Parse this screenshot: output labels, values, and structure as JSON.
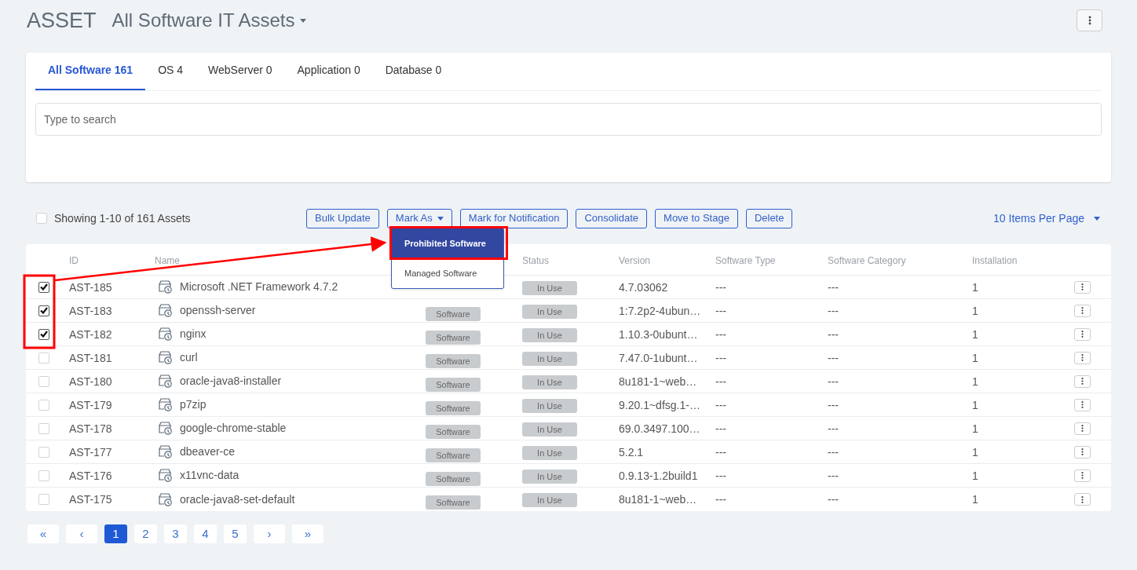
{
  "header": {
    "module": "ASSET",
    "view": "All Software IT Assets"
  },
  "tabs": [
    {
      "label": "All Software 161",
      "selected": true
    },
    {
      "label": "OS 4",
      "selected": false
    },
    {
      "label": "WebServer 0",
      "selected": false
    },
    {
      "label": "Application 0",
      "selected": false
    },
    {
      "label": "Database 0",
      "selected": false
    }
  ],
  "search": {
    "placeholder": "Type to search"
  },
  "toolbar": {
    "select_all_checked": false,
    "summary": "Showing 1-10 of 161 Assets",
    "actions": [
      {
        "label": "Bulk Update",
        "kind": "button"
      },
      {
        "label": "Mark As",
        "kind": "dropdown"
      },
      {
        "label": "Mark for Notification",
        "kind": "button"
      },
      {
        "label": "Consolidate",
        "kind": "button"
      },
      {
        "label": "Move to Stage",
        "kind": "button"
      },
      {
        "label": "Delete",
        "kind": "button"
      }
    ],
    "page_size": "10 Items Per Page"
  },
  "mark_as_menu": [
    {
      "label": "Prohibited Software",
      "selected": true
    },
    {
      "label": "Managed Software",
      "selected": false
    }
  ],
  "table": {
    "columns": [
      "ID",
      "Name",
      "Status",
      "Version",
      "Software Type",
      "Software Category",
      "Installation"
    ],
    "rows": [
      {
        "checked": true,
        "id": "AST-185",
        "name": "Microsoft .NET Framework 4.7.2",
        "status": "In Use",
        "version": "4.7.03062",
        "software_type": "---",
        "category": "---",
        "installation": "1"
      },
      {
        "checked": true,
        "id": "AST-183",
        "name": "openssh-server",
        "type": "Software",
        "status": "In Use",
        "version": "1:7.2p2-4ubun…",
        "software_type": "---",
        "category": "---",
        "installation": "1"
      },
      {
        "checked": true,
        "id": "AST-182",
        "name": "nginx",
        "type": "Software",
        "status": "In Use",
        "version": "1.10.3-0ubunt…",
        "software_type": "---",
        "category": "---",
        "installation": "1"
      },
      {
        "checked": false,
        "id": "AST-181",
        "name": "curl",
        "type": "Software",
        "status": "In Use",
        "version": "7.47.0-1ubunt…",
        "software_type": "---",
        "category": "---",
        "installation": "1"
      },
      {
        "checked": false,
        "id": "AST-180",
        "name": "oracle-java8-installer",
        "type": "Software",
        "status": "In Use",
        "version": "8u181-1~web…",
        "software_type": "---",
        "category": "---",
        "installation": "1"
      },
      {
        "checked": false,
        "id": "AST-179",
        "name": "p7zip",
        "type": "Software",
        "status": "In Use",
        "version": "9.20.1~dfsg.1-…",
        "software_type": "---",
        "category": "---",
        "installation": "1"
      },
      {
        "checked": false,
        "id": "AST-178",
        "name": "google-chrome-stable",
        "type": "Software",
        "status": "In Use",
        "version": "69.0.3497.100…",
        "software_type": "---",
        "category": "---",
        "installation": "1"
      },
      {
        "checked": false,
        "id": "AST-177",
        "name": "dbeaver-ce",
        "type": "Software",
        "status": "In Use",
        "version": "5.2.1",
        "software_type": "---",
        "category": "---",
        "installation": "1"
      },
      {
        "checked": false,
        "id": "AST-176",
        "name": "x11vnc-data",
        "type": "Software",
        "status": "In Use",
        "version": "0.9.13-1.2build1",
        "software_type": "---",
        "category": "---",
        "installation": "1"
      },
      {
        "checked": false,
        "id": "AST-175",
        "name": "oracle-java8-set-default",
        "type": "Software",
        "status": "In Use",
        "version": "8u181-1~web…",
        "software_type": "---",
        "category": "---",
        "installation": "1"
      }
    ]
  },
  "pagination": {
    "first": "«",
    "prev": "‹",
    "pages": [
      {
        "label": "1",
        "selected": true
      },
      {
        "label": "2",
        "selected": false
      },
      {
        "label": "3",
        "selected": false
      },
      {
        "label": "4",
        "selected": false
      },
      {
        "label": "5",
        "selected": false
      }
    ],
    "next": "›",
    "last": "»"
  }
}
